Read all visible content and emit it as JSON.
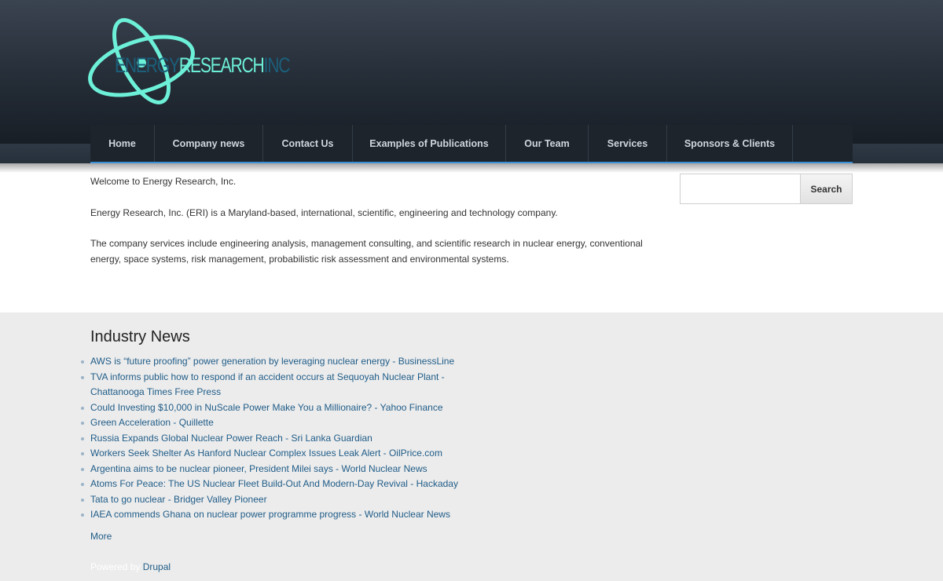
{
  "logo": {
    "part1": "ENERGY",
    "part2": "RESEARCH",
    "part3": "INC"
  },
  "nav": {
    "items": [
      {
        "label": "Home"
      },
      {
        "label": "Company news"
      },
      {
        "label": "Contact Us"
      },
      {
        "label": "Examples of Publications"
      },
      {
        "label": "Our Team"
      },
      {
        "label": "Services"
      },
      {
        "label": "Sponsors & Clients"
      }
    ]
  },
  "main": {
    "welcome": "Welcome to Energy Research, Inc.",
    "intro": "Energy Research, Inc. (ERI) is a Maryland-based, international, scientific, engineering and technology company.",
    "services": "The company services include engineering analysis, management consulting, and scientific research in nuclear energy, conventional energy, space systems, risk management, probabilistic risk assessment and environmental systems."
  },
  "search": {
    "value": "",
    "button_label": "Search"
  },
  "news": {
    "title": "Industry News",
    "items": [
      "AWS is “future proofing” power generation by leveraging nuclear energy - BusinessLine",
      "TVA informs public how to respond if an accident occurs at Sequoyah Nuclear Plant - Chattanooga Times Free Press",
      "Could Investing $10,000 in NuScale Power Make You a Millionaire? - Yahoo Finance",
      "Green Acceleration - Quillette",
      "Russia Expands Global Nuclear Power Reach - Sri Lanka Guardian",
      "Workers Seek Shelter As Hanford Nuclear Complex Issues Leak Alert - OilPrice.com",
      "Argentina aims to be nuclear pioneer, President Milei says - World Nuclear News",
      "Atoms For Peace: The US Nuclear Fleet Build-Out And Modern-Day Revival - Hackaday",
      "Tata to go nuclear - Bridger Valley Pioneer",
      "IAEA commends Ghana on nuclear power programme progress - World Nuclear News"
    ],
    "more_label": "More"
  },
  "footer": {
    "powered_by": "Powered by",
    "drupal": "Drupal"
  },
  "colors": {
    "accent": "#3a8fd6",
    "link": "#1f5c88",
    "logo_teal": "#6df0d8"
  }
}
